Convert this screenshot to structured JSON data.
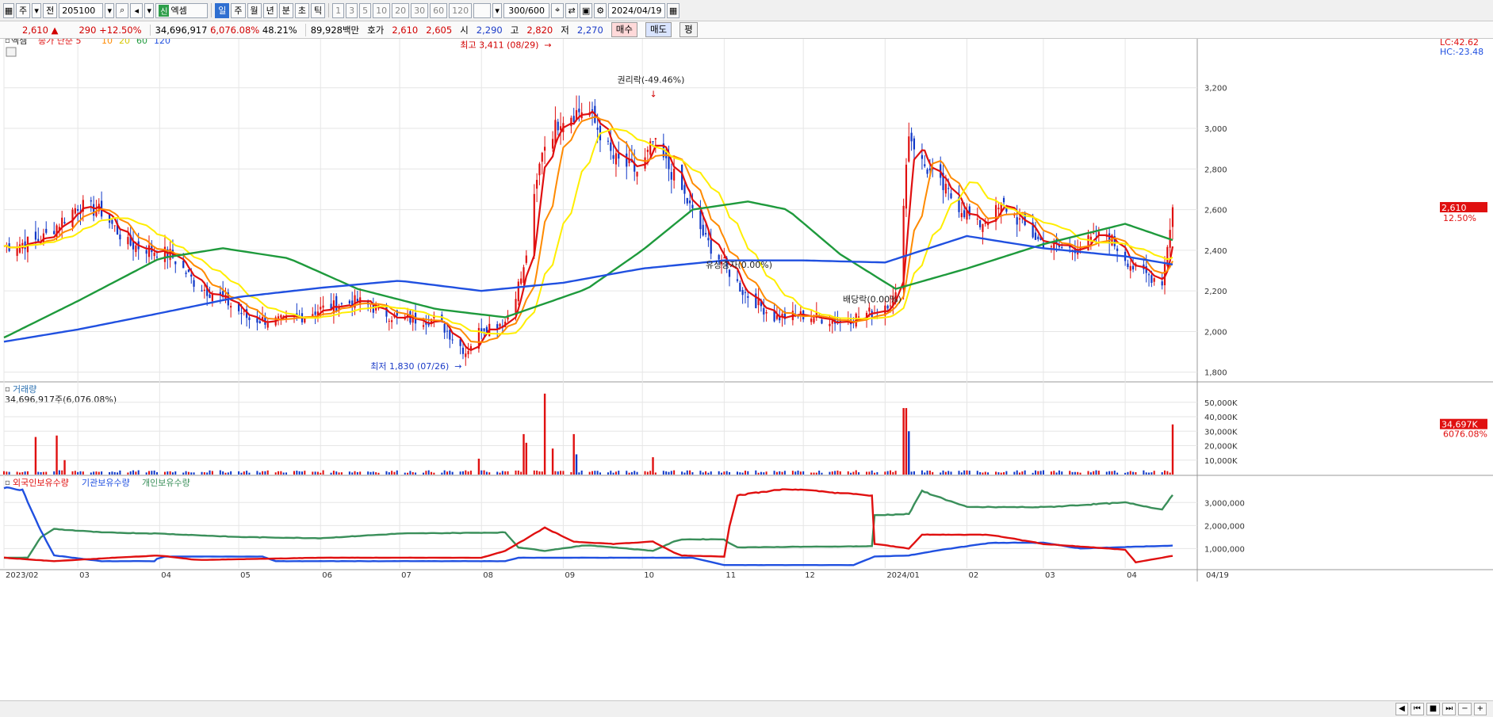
{
  "toolbar": {
    "period_main": "주",
    "market": "전",
    "code": "205100",
    "name_badge": "신",
    "name": "엑셈",
    "periods": [
      "일",
      "주",
      "월",
      "년",
      "분",
      "초",
      "틱"
    ],
    "intervals": [
      "1",
      "3",
      "5",
      "10",
      "20",
      "30",
      "60",
      "120"
    ],
    "count": "300",
    "count_total": "/600",
    "date": "2024/04/19"
  },
  "quote": {
    "price": "2,610",
    "up_arrow": "▲",
    "change": "290",
    "change_pct": "+12.50%",
    "volume": "34,696,917",
    "volume_pct": "6,076.08%",
    "ratio": "48.21%",
    "amount": "89,928백만",
    "ask_label": "호가",
    "ask1": "2,610",
    "ask2": "2,605",
    "open_label": "시",
    "open": "2,290",
    "high_label": "고",
    "high": "2,820",
    "low_label": "저",
    "low": "2,270",
    "buy": "매수",
    "sell": "매도",
    "avg": "평"
  },
  "chart_data": [
    {
      "type": "line",
      "panel": "price",
      "legend_name": "엑셈",
      "ma_label": "종가 단순",
      "ma_periods": [
        "5",
        "10",
        "20",
        "60",
        "120"
      ],
      "colors": {
        "ma5": "#e01010",
        "ma10": "#ff8a00",
        "ma20": "#ffee00",
        "ma60": "#1e9a3c",
        "ma120": "#2050e0",
        "up": "#e01010",
        "down": "#1038c8"
      },
      "ylim": [
        1760,
        3390
      ],
      "yticks": [
        "3,200",
        "3,000",
        "2,800",
        "2,600",
        "2,400",
        "2,200",
        "2,000",
        "1,800"
      ],
      "x_month_labels": [
        "2023/02",
        "03",
        "04",
        "05",
        "06",
        "07",
        "08",
        "09",
        "10",
        "11",
        "12",
        "2024/01",
        "02",
        "03",
        "04",
        "04/19"
      ],
      "right_top_labels": [
        "LC:42.62",
        "HC:-23.48"
      ],
      "last_price_label": "2,610",
      "last_pct_label": "12.50%",
      "last_price": 2610,
      "annotations": [
        {
          "text": "최고 3,411 (08/29)",
          "x": "2023-08-29",
          "y": 3411
        },
        {
          "text": "권리락(-49.46%)",
          "x": "2023-10-05",
          "y": 3130
        },
        {
          "text": "유상증자(0.00%)",
          "x": "2023-11-06",
          "y": 2330
        },
        {
          "text": "배당락(0.00%)",
          "x": "2023-12-28",
          "y": 2160
        },
        {
          "text": "최저 1,830 (07/26)",
          "x": "2023-07-26",
          "y": 1830
        }
      ],
      "close_anchors": [
        [
          "2023-02-01",
          2420
        ],
        [
          "2023-02-15",
          2450
        ],
        [
          "2023-03-01",
          2620
        ],
        [
          "2023-03-10",
          2590
        ],
        [
          "2023-03-20",
          2430
        ],
        [
          "2023-04-05",
          2380
        ],
        [
          "2023-04-15",
          2230
        ],
        [
          "2023-04-25",
          2160
        ],
        [
          "2023-05-05",
          2060
        ],
        [
          "2023-05-20",
          2050
        ],
        [
          "2023-06-01",
          2110
        ],
        [
          "2023-06-15",
          2150
        ],
        [
          "2023-07-01",
          2060
        ],
        [
          "2023-07-15",
          2060
        ],
        [
          "2023-07-26",
          1900
        ],
        [
          "2023-08-01",
          2020
        ],
        [
          "2023-08-10",
          2050
        ],
        [
          "2023-08-17",
          2300
        ],
        [
          "2023-08-24",
          2900
        ],
        [
          "2023-08-31",
          3050
        ],
        [
          "2023-09-10",
          3100
        ],
        [
          "2023-09-20",
          2850
        ],
        [
          "2023-09-30",
          2780
        ],
        [
          "2023-10-05",
          2930
        ],
        [
          "2023-10-15",
          2720
        ],
        [
          "2023-10-25",
          2450
        ],
        [
          "2023-11-01",
          2330
        ],
        [
          "2023-11-08",
          2200
        ],
        [
          "2023-11-20",
          2070
        ],
        [
          "2023-12-01",
          2080
        ],
        [
          "2023-12-15",
          2050
        ],
        [
          "2023-12-28",
          2100
        ],
        [
          "2024-01-05",
          2170
        ],
        [
          "2024-01-10",
          2980
        ],
        [
          "2024-01-15",
          2830
        ],
        [
          "2024-01-22",
          2720
        ],
        [
          "2024-02-05",
          2520
        ],
        [
          "2024-02-15",
          2620
        ],
        [
          "2024-02-28",
          2450
        ],
        [
          "2024-03-10",
          2400
        ],
        [
          "2024-03-25",
          2480
        ],
        [
          "2024-04-05",
          2300
        ],
        [
          "2024-04-15",
          2250
        ],
        [
          "2024-04-19",
          2610
        ]
      ],
      "ma60_anchors": [
        [
          "2023-02-01",
          1970
        ],
        [
          "2023-03-01",
          2150
        ],
        [
          "2023-04-01",
          2360
        ],
        [
          "2023-04-25",
          2410
        ],
        [
          "2023-05-20",
          2360
        ],
        [
          "2023-06-15",
          2210
        ],
        [
          "2023-07-15",
          2110
        ],
        [
          "2023-08-10",
          2070
        ],
        [
          "2023-09-10",
          2210
        ],
        [
          "2023-10-01",
          2400
        ],
        [
          "2023-10-20",
          2600
        ],
        [
          "2023-11-10",
          2640
        ],
        [
          "2023-11-25",
          2600
        ],
        [
          "2023-12-15",
          2380
        ],
        [
          "2024-01-05",
          2210
        ],
        [
          "2024-02-01",
          2310
        ],
        [
          "2024-03-01",
          2430
        ],
        [
          "2024-04-01",
          2530
        ],
        [
          "2024-04-19",
          2450
        ]
      ],
      "ma120_anchors": [
        [
          "2023-02-01",
          1950
        ],
        [
          "2023-03-01",
          2010
        ],
        [
          "2023-04-01",
          2090
        ],
        [
          "2023-05-01",
          2170
        ],
        [
          "2023-06-01",
          2215
        ],
        [
          "2023-07-01",
          2250
        ],
        [
          "2023-08-01",
          2200
        ],
        [
          "2023-09-01",
          2240
        ],
        [
          "2023-10-01",
          2310
        ],
        [
          "2023-11-01",
          2350
        ],
        [
          "2023-12-01",
          2350
        ],
        [
          "2024-01-01",
          2340
        ],
        [
          "2024-02-01",
          2470
        ],
        [
          "2024-03-01",
          2410
        ],
        [
          "2024-04-01",
          2370
        ],
        [
          "2024-04-19",
          2330
        ]
      ]
    },
    {
      "type": "bar",
      "panel": "volume",
      "title": "거래량",
      "subtitle": "34,696,917주(6,076.08%)",
      "yticks": [
        "50,000K",
        "40,000K",
        "30,000K",
        "20,000K",
        "10,000K"
      ],
      "ylim": [
        0,
        57000
      ],
      "last_label": "34,697K",
      "last_pct": "6076.08%",
      "spikes": [
        [
          "2023-02-13",
          26000,
          "up"
        ],
        [
          "2023-02-21",
          27000,
          "up"
        ],
        [
          "2023-02-24",
          10000,
          "up"
        ],
        [
          "2023-07-31",
          11000,
          "up"
        ],
        [
          "2023-08-17",
          28000,
          "up"
        ],
        [
          "2023-08-18",
          22000,
          "up"
        ],
        [
          "2023-08-25",
          56000,
          "up"
        ],
        [
          "2023-08-28",
          18000,
          "up"
        ],
        [
          "2023-09-05",
          28000,
          "up"
        ],
        [
          "2023-09-06",
          14000,
          "down"
        ],
        [
          "2023-10-05",
          12000,
          "up"
        ],
        [
          "2024-01-08",
          46000,
          "up"
        ],
        [
          "2024-01-09",
          46000,
          "up"
        ],
        [
          "2024-01-10",
          30000,
          "down"
        ],
        [
          "2024-04-19",
          34697,
          "up"
        ]
      ]
    },
    {
      "type": "line",
      "panel": "holdings",
      "series_names": [
        "외국인보유수량",
        "기관보유수량",
        "개인보유수량"
      ],
      "colors": [
        "#e01010",
        "#2050e0",
        "#3a8f5a"
      ],
      "yticks": [
        "3,000,000",
        "2,000,000",
        "1,000,000"
      ],
      "ylim": [
        150000,
        3700000
      ],
      "foreign": [
        [
          "2023-02-01",
          600000
        ],
        [
          "2023-02-20",
          450000
        ],
        [
          "2023-03-15",
          600000
        ],
        [
          "2023-04-01",
          700000
        ],
        [
          "2023-04-15",
          500000
        ],
        [
          "2023-06-01",
          600000
        ],
        [
          "2023-08-01",
          600000
        ],
        [
          "2023-08-10",
          900000
        ],
        [
          "2023-08-25",
          1900000
        ],
        [
          "2023-09-05",
          1300000
        ],
        [
          "2023-09-20",
          1200000
        ],
        [
          "2023-10-05",
          1300000
        ],
        [
          "2023-10-15",
          700000
        ],
        [
          "2023-11-01",
          650000
        ],
        [
          "2023-11-05",
          3300000
        ],
        [
          "2023-11-25",
          3600000
        ],
        [
          "2023-12-27",
          3300000
        ],
        [
          "2023-12-28",
          1200000
        ],
        [
          "2024-01-10",
          1000000
        ],
        [
          "2024-01-15",
          1600000
        ],
        [
          "2024-02-10",
          1600000
        ],
        [
          "2024-03-01",
          1200000
        ],
        [
          "2024-04-01",
          950000
        ],
        [
          "2024-04-05",
          400000
        ],
        [
          "2024-04-19",
          680000
        ]
      ],
      "institution": [
        [
          "2023-02-01",
          3650000
        ],
        [
          "2023-02-08",
          3550000
        ],
        [
          "2023-02-14",
          2000000
        ],
        [
          "2023-02-20",
          700000
        ],
        [
          "2023-03-10",
          450000
        ],
        [
          "2023-03-30",
          450000
        ],
        [
          "2023-04-01",
          650000
        ],
        [
          "2023-05-10",
          650000
        ],
        [
          "2023-05-15",
          450000
        ],
        [
          "2023-08-10",
          450000
        ],
        [
          "2023-08-15",
          600000
        ],
        [
          "2023-10-20",
          600000
        ],
        [
          "2023-11-01",
          280000
        ],
        [
          "2023-12-20",
          280000
        ],
        [
          "2023-12-28",
          650000
        ],
        [
          "2024-01-10",
          700000
        ],
        [
          "2024-01-20",
          900000
        ],
        [
          "2024-02-10",
          1250000
        ],
        [
          "2024-03-01",
          1250000
        ],
        [
          "2024-03-15",
          1000000
        ],
        [
          "2024-04-19",
          1130000
        ]
      ],
      "individual": [
        [
          "2023-02-01",
          600000
        ],
        [
          "2023-02-10",
          600000
        ],
        [
          "2023-02-15",
          1500000
        ],
        [
          "2023-02-20",
          1850000
        ],
        [
          "2023-03-10",
          1700000
        ],
        [
          "2023-04-01",
          1650000
        ],
        [
          "2023-05-01",
          1500000
        ],
        [
          "2023-06-01",
          1450000
        ],
        [
          "2023-07-01",
          1650000
        ],
        [
          "2023-08-10",
          1700000
        ],
        [
          "2023-08-15",
          1050000
        ],
        [
          "2023-08-25",
          900000
        ],
        [
          "2023-09-10",
          1150000
        ],
        [
          "2023-10-05",
          900000
        ],
        [
          "2023-10-15",
          1400000
        ],
        [
          "2023-11-01",
          1400000
        ],
        [
          "2023-11-05",
          1050000
        ],
        [
          "2023-12-27",
          1100000
        ],
        [
          "2023-12-28",
          2450000
        ],
        [
          "2024-01-10",
          2500000
        ],
        [
          "2024-01-15",
          3500000
        ],
        [
          "2024-02-01",
          2800000
        ],
        [
          "2024-03-01",
          2800000
        ],
        [
          "2024-04-01",
          3000000
        ],
        [
          "2024-04-15",
          2700000
        ],
        [
          "2024-04-19",
          3350000
        ]
      ]
    }
  ]
}
